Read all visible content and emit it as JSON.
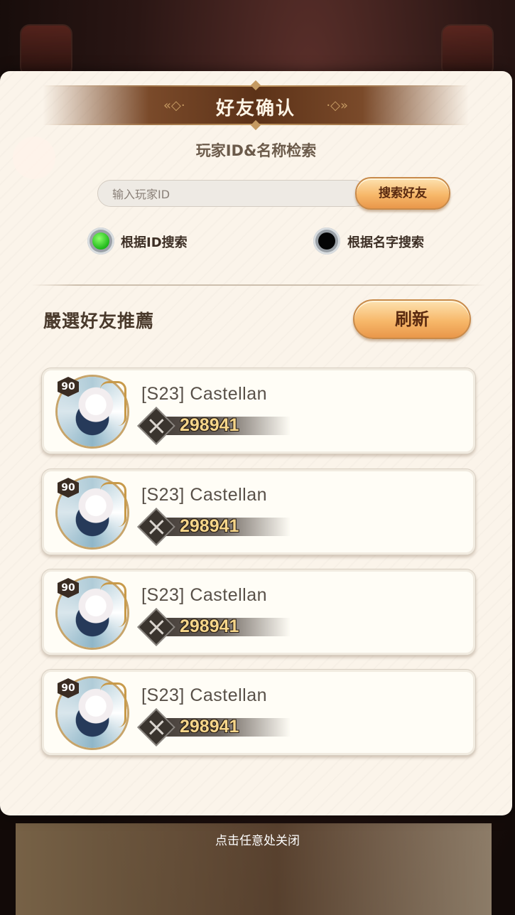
{
  "dialog": {
    "title": "好友确认",
    "search_heading": "玩家ID&名称检索",
    "search_placeholder": "输入玩家ID",
    "search_value": "",
    "search_button": "搜索好友",
    "radio_options": [
      {
        "label": "根据ID搜索",
        "selected": true
      },
      {
        "label": "根据名字搜索",
        "selected": false
      }
    ],
    "recommend_title": "嚴選好友推薦",
    "refresh_button": "刷新"
  },
  "friends": [
    {
      "level": "90",
      "name": "[S23] Castellan",
      "power": "298941"
    },
    {
      "level": "90",
      "name": "[S23] Castellan",
      "power": "298941"
    },
    {
      "level": "90",
      "name": "[S23] Castellan",
      "power": "298941"
    },
    {
      "level": "90",
      "name": "[S23] Castellan",
      "power": "298941"
    }
  ],
  "close_hint": "点击任意处关闭",
  "colors": {
    "modal_bg": "#fbf4ea",
    "title_bar": "#5c3218",
    "button_gold": "#f7b86a",
    "radio_on": "#1fb81a",
    "power_text": "#f5d58a"
  },
  "icons": [
    "gift-box-icon",
    "heart-mail-icon",
    "power-swords-icon",
    "level-badge-icon"
  ]
}
